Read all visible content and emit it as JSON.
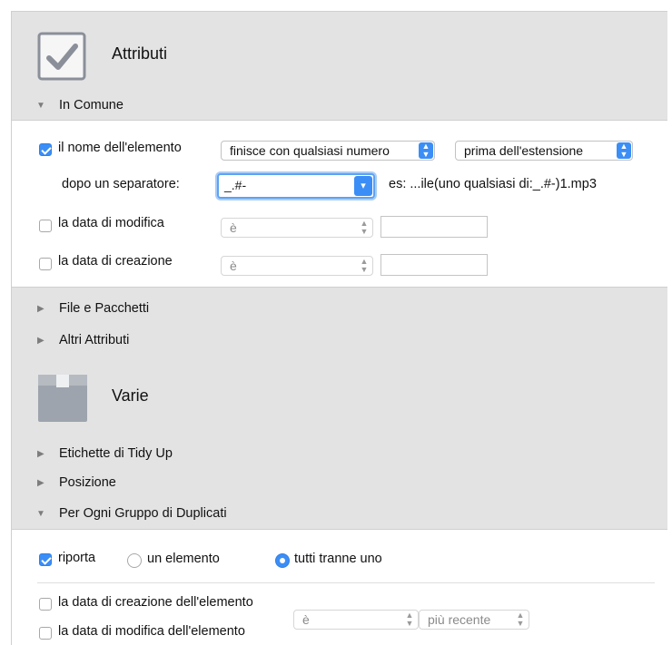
{
  "attributes": {
    "title": "Attributi",
    "icon": "checkbox-check-icon",
    "common": {
      "label": "In Comune",
      "name_row": {
        "label": "il nome dell'elemento",
        "checked": true,
        "condition": "finisce con qualsiasi numero",
        "position": "prima dell'estensione"
      },
      "separator_row": {
        "label": "dopo un separatore:",
        "value": "_.#-",
        "example": "es: ...ile(uno qualsiasi di:_.#-)1.mp3"
      },
      "modified_row": {
        "label": "la data di modifica",
        "checked": false,
        "operator": "è",
        "value": ""
      },
      "created_row": {
        "label": "la data di creazione",
        "checked": false,
        "operator": "è",
        "value": ""
      }
    },
    "files_packages": "File e Pacchetti",
    "other_attributes": "Altri Attributi"
  },
  "misc": {
    "title": "Varie",
    "icon": "box-icon",
    "labels": "Etichette di Tidy Up",
    "position": "Posizione",
    "per_group": {
      "label": "Per Ogni Gruppo di Duplicati",
      "report_label": "riporta",
      "report_checked": true,
      "option_one": "un elemento",
      "option_all_but_one": "tutti tranne uno",
      "selected_option": "tutti tranne uno",
      "creation_label": "la data di creazione dell'elemento",
      "modification_label": "la data di modifica dell'elemento",
      "date_operator": "è",
      "order": "più recente"
    }
  },
  "colors": {
    "accent": "#3b8ef5",
    "background": "#e3e3e3",
    "panel": "#ffffff"
  }
}
